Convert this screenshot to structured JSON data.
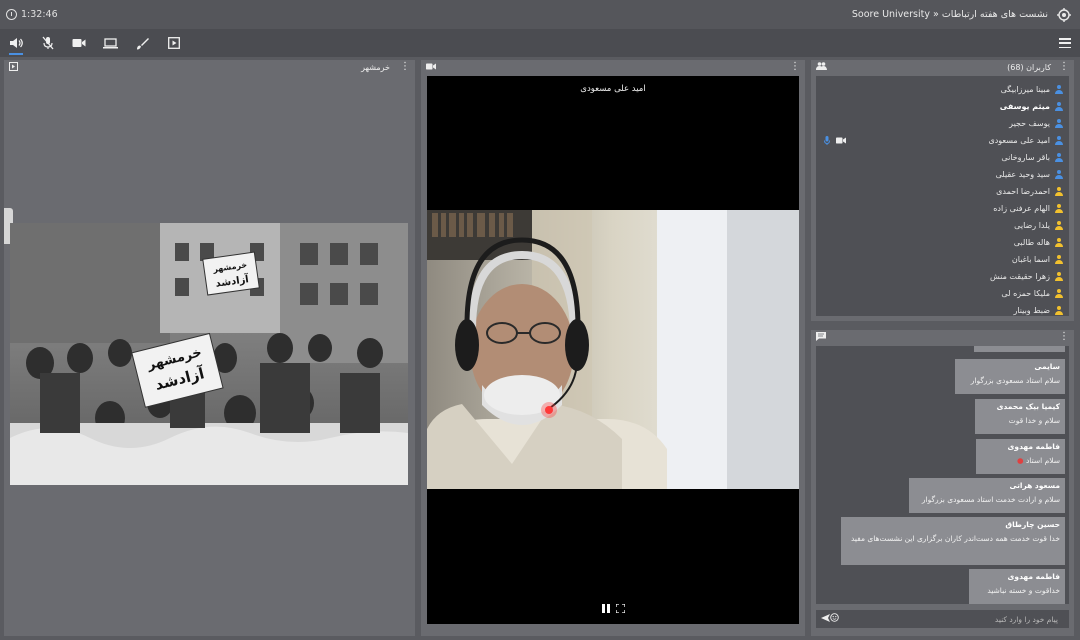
{
  "topbar": {
    "clock": "1:32:46",
    "title": "Soore University » نشست های هفته ارتباطات",
    "logo": "university-logo"
  },
  "toolbar": {
    "items": [
      {
        "name": "speaker-icon",
        "active": true
      },
      {
        "name": "mic-muted-icon",
        "active": false
      },
      {
        "name": "camera-icon",
        "active": false
      },
      {
        "name": "screen-share-icon",
        "active": false
      },
      {
        "name": "brush-icon",
        "active": false
      },
      {
        "name": "media-play-icon",
        "active": false
      }
    ],
    "menu_icon": "hamburger-icon"
  },
  "share_panel": {
    "title": "خرمشهر",
    "photo_poster_text": "خرمشهر آزاد شد"
  },
  "video_panel": {
    "speaker_name": "امید علی مسعودی"
  },
  "users_panel": {
    "title": "کاربران (68)",
    "users": [
      {
        "name": "مبینا میرزابیگی",
        "role": "listener",
        "bold": false
      },
      {
        "name": "میثم یوسفی",
        "role": "listener",
        "bold": true
      },
      {
        "name": "یوسف حجیر",
        "role": "listener",
        "bold": false
      },
      {
        "name": "امید علی مسعودی",
        "role": "listener",
        "bold": false,
        "mic": true,
        "cam": true
      },
      {
        "name": "باقر ساروخانی",
        "role": "listener",
        "bold": false
      },
      {
        "name": "سید وحید عقیلی",
        "role": "listener",
        "bold": false
      },
      {
        "name": "احمدرضا احمدی",
        "role": "guest",
        "bold": false
      },
      {
        "name": "الهام عرفنی زاده",
        "role": "guest",
        "bold": false
      },
      {
        "name": "یلدا رضایی",
        "role": "guest",
        "bold": false
      },
      {
        "name": "هاله طالبی",
        "role": "guest",
        "bold": false
      },
      {
        "name": "اسما باغبان",
        "role": "guest",
        "bold": false
      },
      {
        "name": "زهرا حقیقت منش",
        "role": "guest",
        "bold": false
      },
      {
        "name": "ملیکا حمزه لی",
        "role": "guest",
        "bold": false
      },
      {
        "name": "ضبط وبینار",
        "role": "guest",
        "bold": false
      }
    ]
  },
  "chat_panel": {
    "messages": [
      {
        "sender": "سایمی",
        "text": "سلام استاد مسعودی بزرگوار"
      },
      {
        "sender": "کیمیا بیک محمدی",
        "text": "سلام و خدا قوت"
      },
      {
        "sender": "فاطمه مهدوی",
        "text": "سلام استاد"
      },
      {
        "sender": "مسعود هراتی",
        "text": "سلام و ارادت خدمت استاد مسعودی بزرگوار"
      },
      {
        "sender": "حسین چارطاق",
        "text": "خدا قوت خدمت همه دست‌اندر کاران برگزاری این نشست‌های مفید"
      },
      {
        "sender": "فاطمه مهدوی",
        "text": "خداقوت و خسته نباشید"
      }
    ],
    "input_placeholder": "پیام خود را وارد کنید"
  },
  "colors": {
    "listener_icon": "#4a90e2",
    "guest_icon": "#f2c12e",
    "active_underline": "#4a90e2"
  }
}
